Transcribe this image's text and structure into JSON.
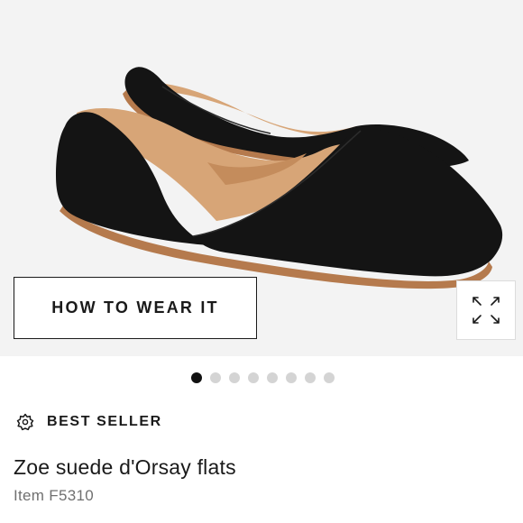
{
  "gallery": {
    "image_alt": "Zoe suede d'Orsay flats",
    "how_to_wear_label": "HOW TO WEAR IT",
    "expand_icon": "expand-icon",
    "slide_count": 8,
    "active_slide": 1
  },
  "badge": {
    "icon": "starburst-icon",
    "label": "BEST SELLER"
  },
  "product": {
    "title": "Zoe suede d'Orsay flats",
    "item_number": "Item F5310"
  },
  "colors": {
    "shoe": "#141414",
    "lining": "#d7a577",
    "sole": "#b57a4d",
    "gallery_bg": "#f3f3f3",
    "dot_active": "#111111",
    "dot_inactive": "#d4d4d4"
  }
}
